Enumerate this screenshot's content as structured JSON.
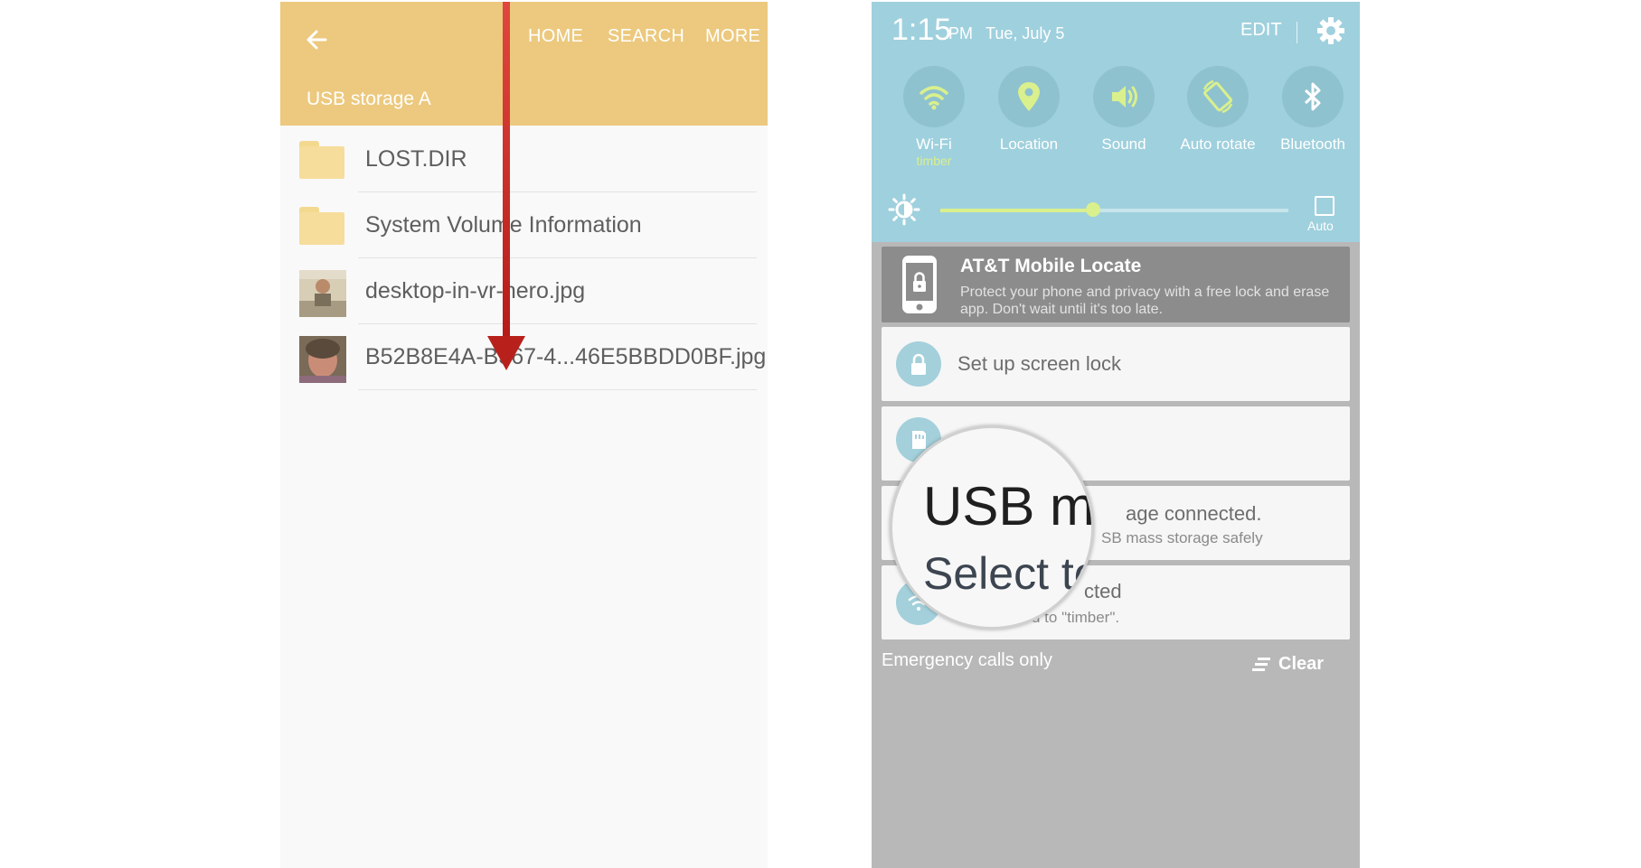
{
  "left_phone": {
    "header": {
      "back_icon": "arrow-left-icon",
      "actions": [
        "HOME",
        "SEARCH",
        "MORE"
      ],
      "subtitle": "USB storage A",
      "color": "#ecc97e"
    },
    "files": [
      {
        "name": "LOST.DIR",
        "type": "folder"
      },
      {
        "name": "System Volume Information",
        "type": "folder"
      },
      {
        "name": "desktop-in-vr-hero.jpg",
        "type": "image"
      },
      {
        "name": "B52B8E4A-B367-4...46E5BBDD0BF.jpg",
        "type": "image"
      }
    ],
    "overlay_arrow": {
      "direction": "down",
      "color": "#c4201b"
    }
  },
  "right_phone": {
    "status": {
      "time": "1:15",
      "ampm": "PM",
      "date": "Tue, July 5",
      "edit_label": "EDIT",
      "settings_icon": "gear-icon"
    },
    "quick_tiles": [
      {
        "label": "Wi-Fi",
        "sublabel": "timber",
        "icon": "wifi-icon"
      },
      {
        "label": "Location",
        "sublabel": "",
        "icon": "location-pin-icon"
      },
      {
        "label": "Sound",
        "sublabel": "",
        "icon": "speaker-icon"
      },
      {
        "label": "Auto rotate",
        "sublabel": "",
        "icon": "rotate-icon"
      },
      {
        "label": "Bluetooth",
        "sublabel": "",
        "icon": "bluetooth-icon"
      }
    ],
    "brightness": {
      "level": 0.44,
      "auto_label": "Auto"
    },
    "notifications": [
      {
        "title": "AT&T Mobile Locate",
        "text": "Protect your phone and privacy with a free lock and erase app. Don't wait until it's too late.",
        "icon": "phone-lock-icon"
      },
      {
        "title": "Set up screen lock",
        "text": "",
        "icon": "lock-icon"
      },
      {
        "title": "",
        "text": "",
        "icon": "sd-card-icon"
      },
      {
        "title": "age connected.",
        "text": "SB mass storage safely",
        "icon": "usb-icon"
      },
      {
        "title": "cted",
        "text": "d to \"timber\".",
        "icon": "wifi-icon"
      }
    ],
    "magnifier": {
      "line1": "USB m",
      "line2": "Select to"
    },
    "footer": {
      "emergency": "Emergency calls only",
      "clear_label": "Clear"
    },
    "colors": {
      "panel": "#9fd0dd",
      "accent": "#d9f08d",
      "shade": "#b8b8b8"
    }
  }
}
